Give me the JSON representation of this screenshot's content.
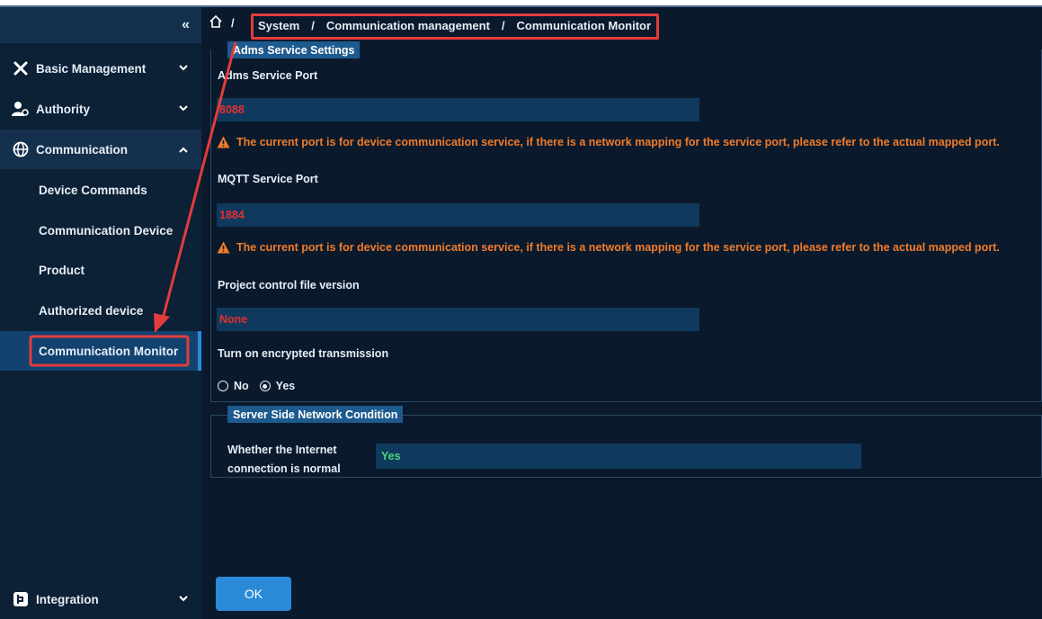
{
  "sidebar": {
    "collapse_icon": "«",
    "items": [
      {
        "label": "Basic Management",
        "icon": "tools-icon"
      },
      {
        "label": "Authority",
        "icon": "user-gear-icon"
      },
      {
        "label": "Communication",
        "icon": "globe-icon"
      }
    ],
    "sub_items": [
      "Device Commands",
      "Communication Device",
      "Product",
      "Authorized device",
      "Communication Monitor"
    ],
    "integration": {
      "label": "Integration",
      "icon": "integration-icon"
    }
  },
  "breadcrumb": {
    "home_icon": "home-icon",
    "separator": "/",
    "items": [
      "System",
      "Communication management",
      "Communication Monitor"
    ]
  },
  "adms": {
    "legend": "Adms Service Settings",
    "port_label": "Adms Service Port",
    "port_value": "8088",
    "warning": "The current port is for device communication service, if there is a network mapping for the service port, please refer to the actual mapped port.",
    "mqtt_label": "MQTT Service Port",
    "mqtt_value": "1884",
    "mqtt_warning": "The current port is for device communication service, if there is a network mapping for the service port, please refer to the actual mapped port.",
    "version_label": "Project control file version",
    "version_value": "None",
    "encrypt_label": "Turn on encrypted transmission",
    "opt_no": "No",
    "opt_yes": "Yes",
    "selected": "Yes"
  },
  "network": {
    "legend": "Server Side Network Condition",
    "label_line1": "Whether the Internet",
    "label_line2": "connection is normal",
    "value": "Yes"
  },
  "ok_label": "OK",
  "colors": {
    "accent": "#2b8ad8",
    "warning": "#f07b2a",
    "error_value": "#e23030",
    "ok_value": "#4cd67a",
    "annotation": "#e33c3c"
  }
}
